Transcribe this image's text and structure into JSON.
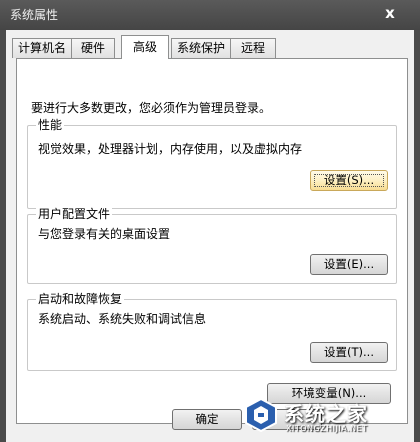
{
  "window": {
    "title": "系统属性",
    "close_glyph": "x"
  },
  "tabs": [
    {
      "label": "计算机名",
      "active": false
    },
    {
      "label": "硬件",
      "active": false
    },
    {
      "label": "高级",
      "active": true
    },
    {
      "label": "系统保护",
      "active": false
    },
    {
      "label": "远程",
      "active": false
    }
  ],
  "advanced": {
    "intro": "要进行大多数更改，您必须作为管理员登录。",
    "performance": {
      "title": "性能",
      "description": "视觉效果，处理器计划，内存使用，以及虚拟内存",
      "button": "设置(S)..."
    },
    "user_profiles": {
      "title": "用户配置文件",
      "description": "与您登录有关的桌面设置",
      "button": "设置(E)..."
    },
    "startup_recovery": {
      "title": "启动和故障恢复",
      "description": "系统启动、系统失败和调试信息",
      "button": "设置(T)..."
    },
    "env_button": "环境变量(N)..."
  },
  "footer": {
    "ok": "确定"
  },
  "watermark": {
    "brand": "系统之家",
    "url": "XITONGZHIJIA.NET"
  }
}
